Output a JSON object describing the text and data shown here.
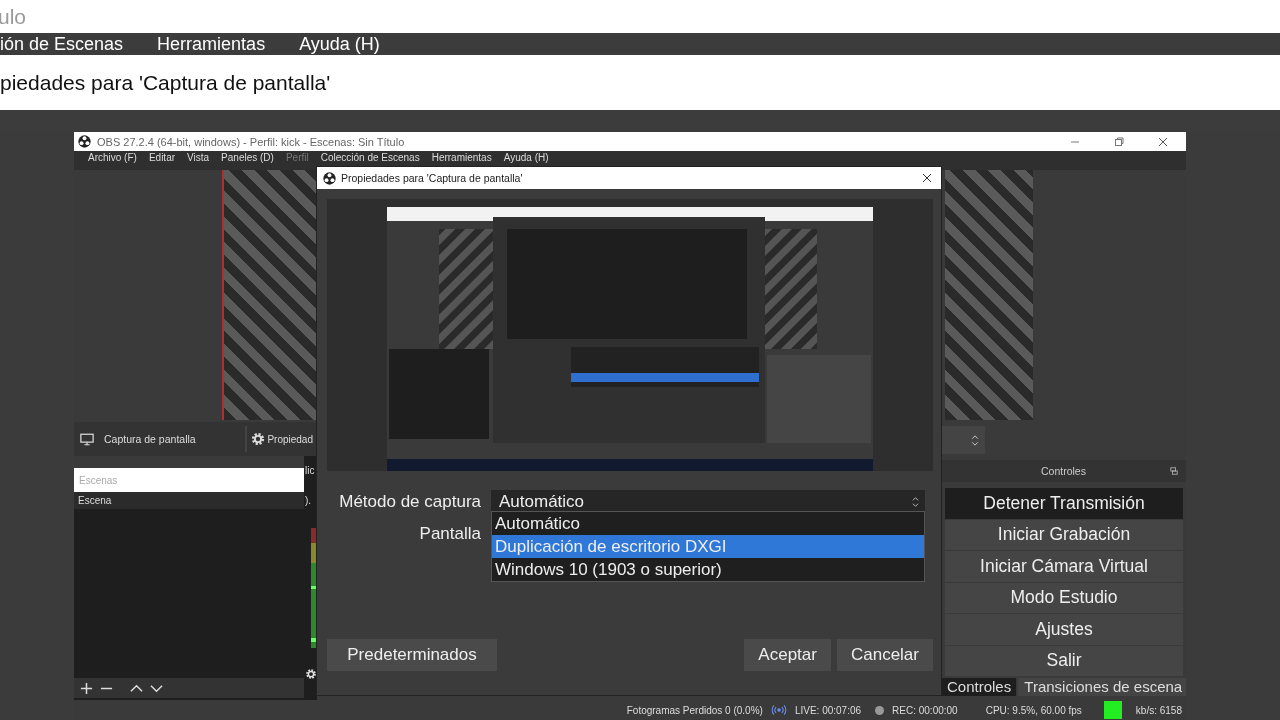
{
  "background_layers": {
    "title_fragment": "ulo",
    "menu_fragments": [
      "ión de Escenas",
      "Herramientas",
      "Ayuda (H)"
    ],
    "dialog_title_fragment": "piedades para 'Captura de pantalla'"
  },
  "window": {
    "title": "OBS 27.2.4 (64-bit, windows) - Perfil: kick - Escenas: Sin Título",
    "menu": [
      {
        "label": "Archivo (F)",
        "disabled": false
      },
      {
        "label": "Editar",
        "disabled": false
      },
      {
        "label": "Vista",
        "disabled": false
      },
      {
        "label": "Paneles (D)",
        "disabled": false
      },
      {
        "label": "Perfil",
        "disabled": true
      },
      {
        "label": "Colección de Escenas",
        "disabled": false
      },
      {
        "label": "Herramientas",
        "disabled": false
      },
      {
        "label": "Ayuda (H)",
        "disabled": false
      }
    ]
  },
  "sources_toolbar": {
    "source": "Captura de pantalla",
    "properties": "Propiedad"
  },
  "scenes": {
    "placeholder": "Escenas",
    "items": [
      {
        "label": "Escena",
        "selected": true
      }
    ]
  },
  "mixer_fragments": [
    "lic",
    ")."
  ],
  "controls": {
    "title": "Controles",
    "buttons": [
      {
        "label": "Detener Transmisión",
        "active": true
      },
      {
        "label": "Iniciar Grabación",
        "active": false
      },
      {
        "label": "Iniciar Cámara Virtual",
        "active": false
      },
      {
        "label": "Modo Estudio",
        "active": false
      },
      {
        "label": "Ajustes",
        "active": false
      },
      {
        "label": "Salir",
        "active": false
      }
    ]
  },
  "dock_tabs": [
    {
      "label": "Controles",
      "selected": true
    },
    {
      "label": "Transiciones de escena",
      "selected": false
    }
  ],
  "status_bar": {
    "dropped": "Fotogramas Perdidos 0 (0.0%)",
    "live": "LIVE: 00:07:06",
    "rec": "REC: 00:00:00",
    "cpu": "CPU: 9.5%, 60.00 fps",
    "kbps": "kb/s: 6158"
  },
  "dialog": {
    "title": "Propiedades para 'Captura de pantalla'",
    "fields": [
      {
        "label": "Método de captura",
        "value": "Automático"
      },
      {
        "label": "Pantalla"
      }
    ],
    "dropdown": {
      "options": [
        {
          "label": "Automático",
          "selected": false
        },
        {
          "label": "Duplicación de escritorio DXGI",
          "selected": true
        },
        {
          "label": "Windows 10 (1903 o superior)",
          "selected": false
        }
      ]
    },
    "buttons": [
      "Predeterminados",
      "Aceptar",
      "Cancelar"
    ]
  }
}
